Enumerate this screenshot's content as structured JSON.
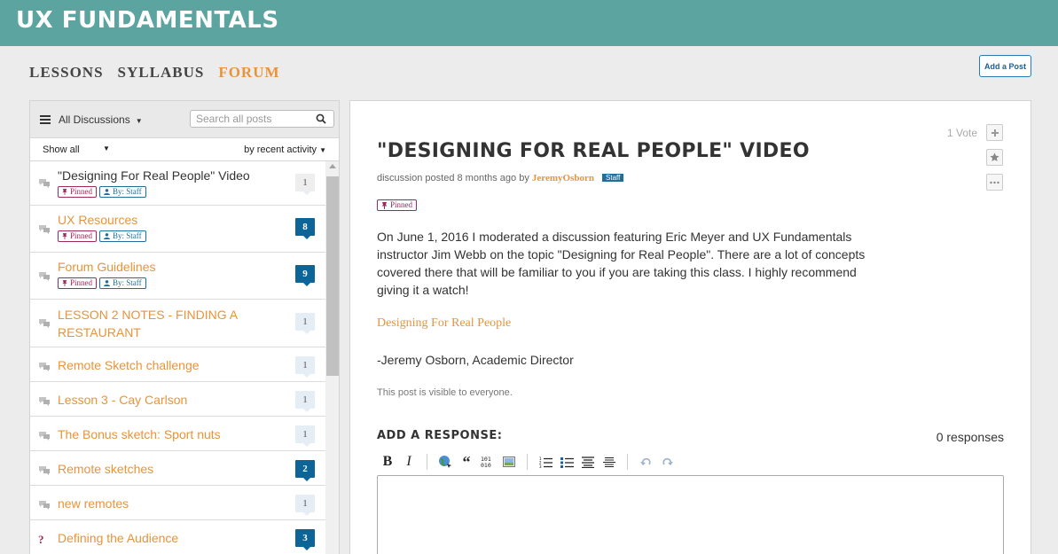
{
  "app": {
    "title": "UX FUNDAMENTALS"
  },
  "nav": {
    "lessons": "LESSONS",
    "syllabus": "SYLLABUS",
    "forum": "FORUM"
  },
  "add_post_label": "Add a Post",
  "sidebar": {
    "filter_label": "All Discussions",
    "search_placeholder": "Search all posts",
    "show_all": "Show all",
    "sort_label": "by recent activity",
    "items": [
      {
        "title": "\"Designing For Real People\" Video",
        "count": "1",
        "read": true,
        "pinned": true,
        "staff": true,
        "dark": false
      },
      {
        "title": "UX Resources",
        "count": "8",
        "read": false,
        "pinned": true,
        "staff": true,
        "dark": true
      },
      {
        "title": "Forum Guidelines",
        "count": "9",
        "read": false,
        "pinned": true,
        "staff": true,
        "dark": true
      },
      {
        "title": "LESSON 2 NOTES - FINDING A RESTAURANT",
        "count": "1",
        "read": false,
        "dark": false
      },
      {
        "title": "Remote Sketch challenge",
        "count": "1",
        "read": false,
        "dark": false
      },
      {
        "title": "Lesson 3 - Cay Carlson",
        "count": "1",
        "read": false,
        "dark": false
      },
      {
        "title": "The Bonus sketch: Sport nuts",
        "count": "1",
        "read": false,
        "dark": false
      },
      {
        "title": "Remote sketches",
        "count": "2",
        "read": false,
        "dark": true
      },
      {
        "title": "new remotes",
        "count": "1",
        "read": false,
        "dark": false
      },
      {
        "title": "Defining the Audience",
        "count": "3",
        "read": false,
        "dark": true,
        "question": true
      }
    ],
    "tag_pinned": "Pinned",
    "tag_staff": "By: Staff"
  },
  "post": {
    "votes": "1 Vote",
    "title": "\"DESIGNING FOR REAL PEOPLE\" VIDEO",
    "meta_prefix": "discussion posted 8 months ago by",
    "author": "JeremyOsborn",
    "author_badge": "Staff",
    "pinned_label": "Pinned",
    "body": "On June 1, 2016 I moderated a discussion featuring Eric Meyer and UX Fundamentals instructor Jim Webb on the topic \"Designing for Real People\". There are a lot of concepts covered there that will be familiar to you if you are taking this class. I highly recommend giving it a watch!",
    "link_text": "Designing For Real People",
    "signature": "-Jeremy Osborn, Academic Director",
    "visibility": "This post is visible to everyone."
  },
  "response": {
    "heading": "ADD A RESPONSE:",
    "count": "0 responses"
  },
  "colors": {
    "header": "#5ba4a0",
    "accent": "#e8943a",
    "blue": "#0d6496",
    "pinned": "#a0285a"
  }
}
